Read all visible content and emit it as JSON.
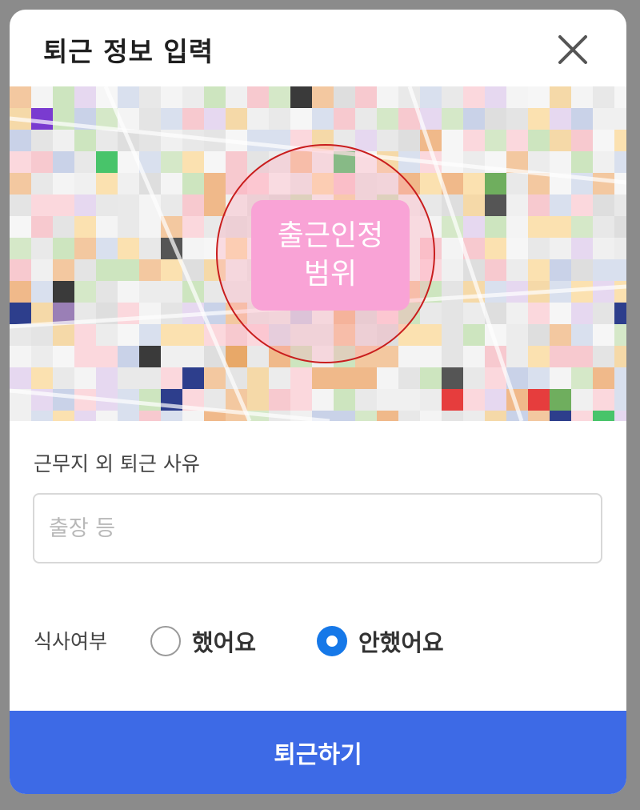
{
  "dialog": {
    "title": "퇴근 정보 입력",
    "close_icon": "close-icon"
  },
  "map": {
    "range_label": "출근인정\n범위",
    "range_border_color": "#c91d1d",
    "range_label_color": "#f9a3d6"
  },
  "reason": {
    "label": "근무지 외 퇴근 사유",
    "value": "",
    "placeholder": "출장 등"
  },
  "meal": {
    "label": "식사여부",
    "options": [
      {
        "label": "했어요",
        "selected": false
      },
      {
        "label": "안했어요",
        "selected": true
      }
    ]
  },
  "submit": {
    "label": "퇴근하기",
    "color": "#3d6ae6"
  }
}
